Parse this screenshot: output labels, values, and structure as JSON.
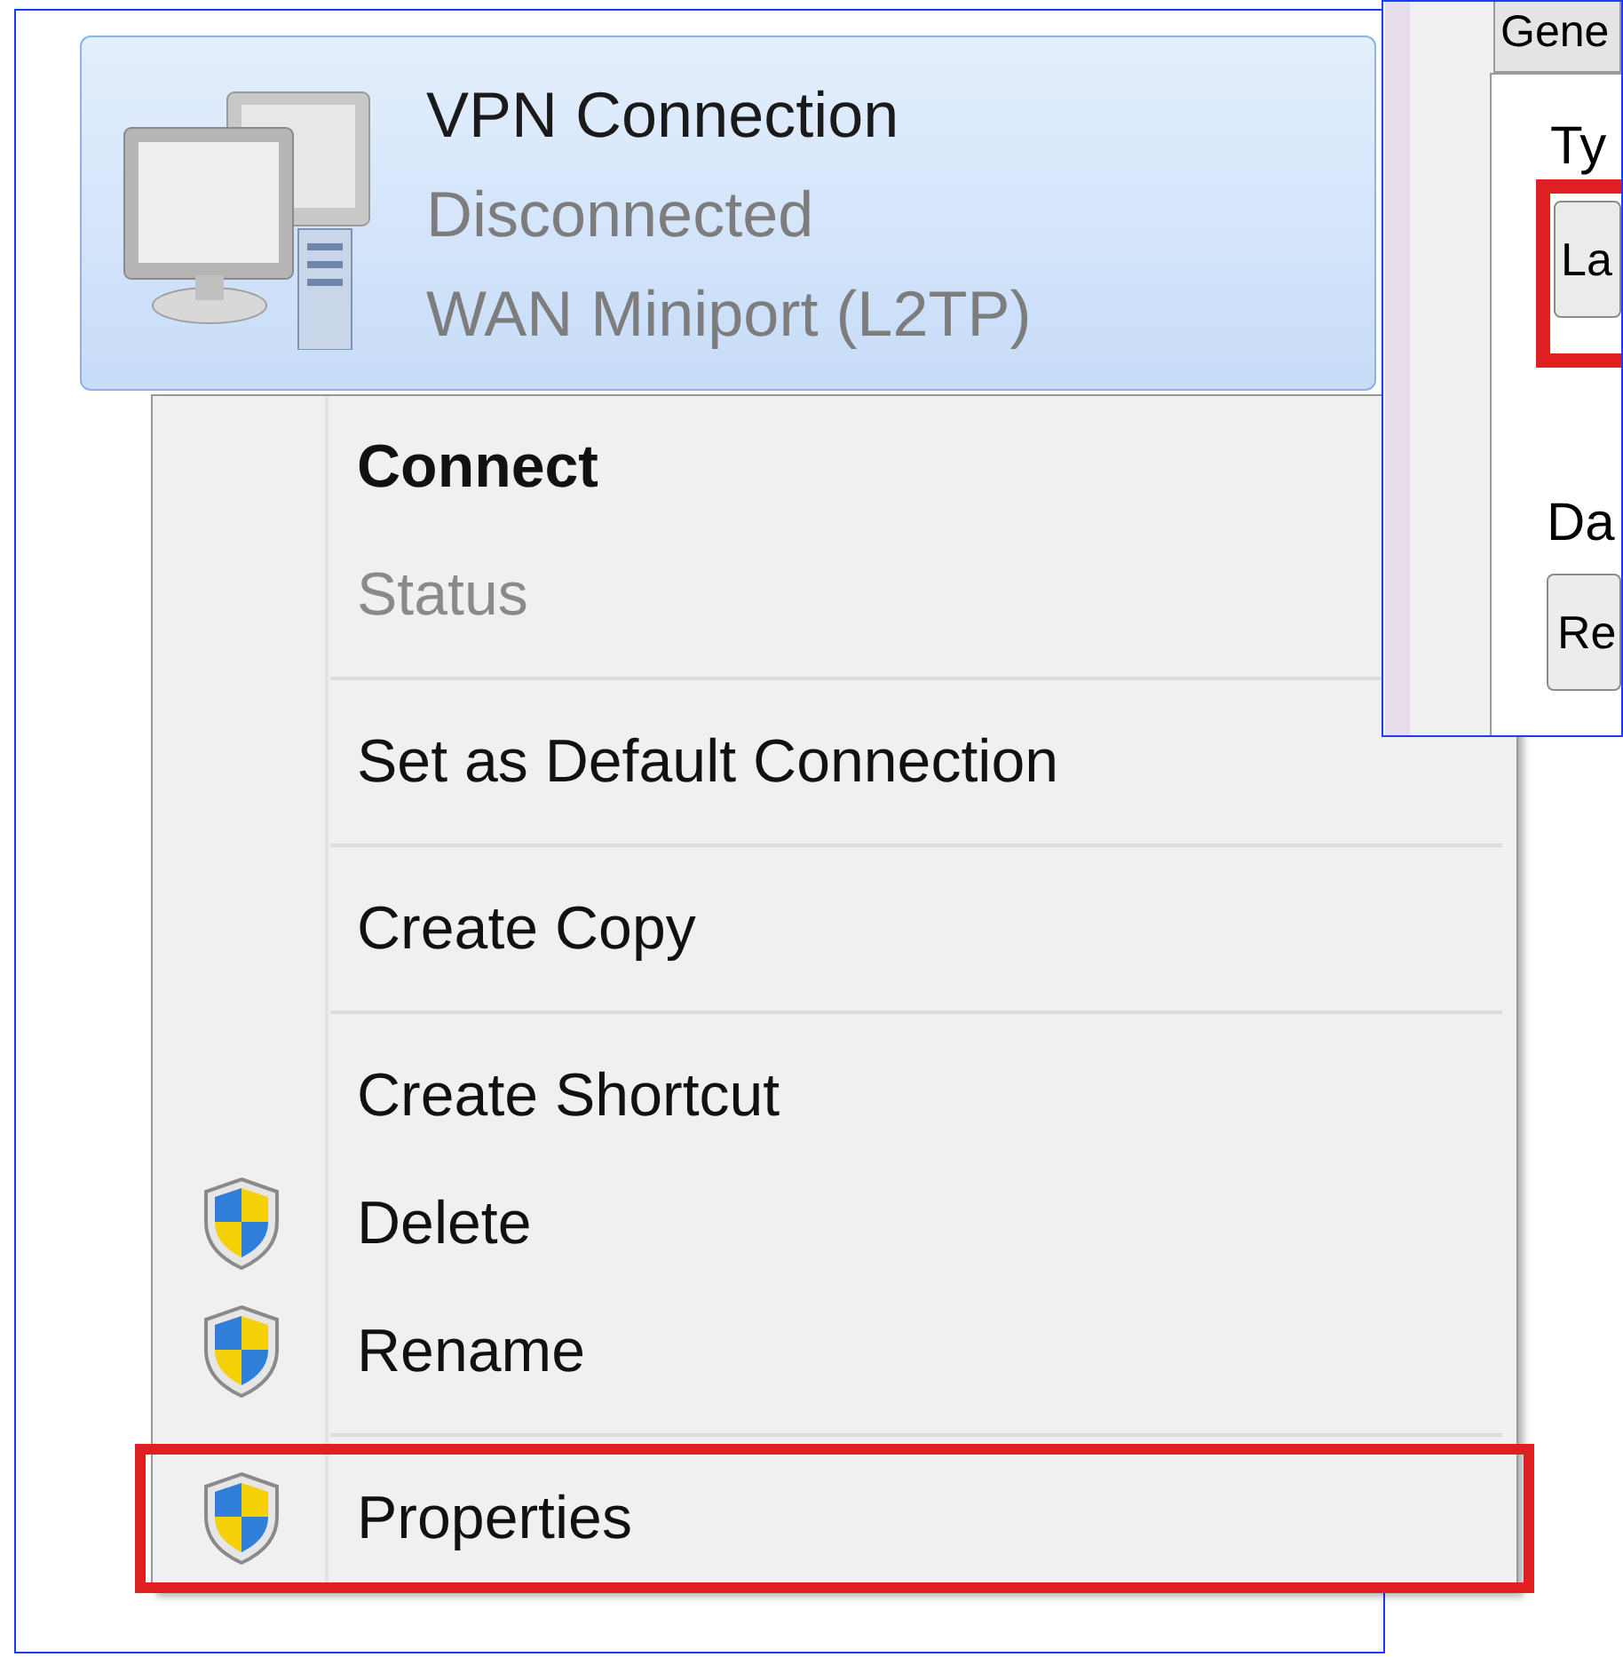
{
  "connection": {
    "name": "VPN Connection",
    "status": "Disconnected",
    "device": "WAN Miniport (L2TP)",
    "selected": true
  },
  "context_menu": {
    "items": [
      {
        "kind": "item",
        "label": "Connect",
        "default": true,
        "disabled": false,
        "shield": false,
        "highlighted": false
      },
      {
        "kind": "item",
        "label": "Status",
        "default": false,
        "disabled": true,
        "shield": false,
        "highlighted": false
      },
      {
        "kind": "separator"
      },
      {
        "kind": "item",
        "label": "Set as Default Connection",
        "default": false,
        "disabled": false,
        "shield": false,
        "highlighted": false
      },
      {
        "kind": "separator"
      },
      {
        "kind": "item",
        "label": "Create Copy",
        "default": false,
        "disabled": false,
        "shield": false,
        "highlighted": false
      },
      {
        "kind": "separator"
      },
      {
        "kind": "item",
        "label": "Create Shortcut",
        "default": false,
        "disabled": false,
        "shield": false,
        "highlighted": false
      },
      {
        "kind": "item",
        "label": "Delete",
        "default": false,
        "disabled": false,
        "shield": true,
        "highlighted": false
      },
      {
        "kind": "item",
        "label": "Rename",
        "default": false,
        "disabled": false,
        "shield": true,
        "highlighted": false
      },
      {
        "kind": "separator"
      },
      {
        "kind": "item",
        "label": "Properties",
        "default": false,
        "disabled": false,
        "shield": true,
        "highlighted": true
      }
    ]
  },
  "properties_window": {
    "tab": "Gene",
    "type_label": "Ty",
    "type_button": {
      "label": "La",
      "highlighted": true
    },
    "data_label": "Da",
    "data_button": "Re"
  }
}
